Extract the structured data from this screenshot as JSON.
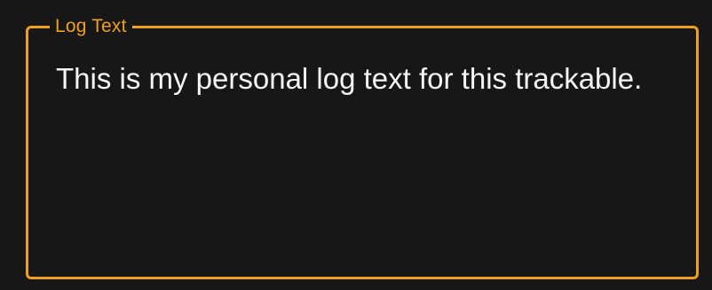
{
  "log_text_field": {
    "label": "Log Text",
    "value": "This is my personal log text for this trackable."
  },
  "colors": {
    "background": "#171717",
    "accent": "#f0a020",
    "text": "#f5f5f5"
  }
}
